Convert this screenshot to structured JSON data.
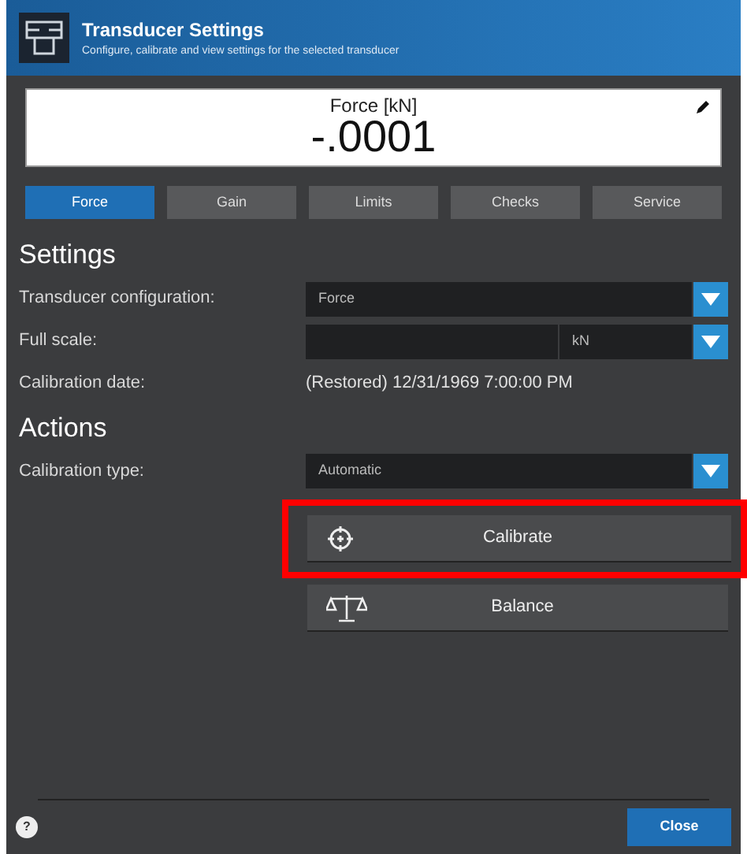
{
  "header": {
    "title": "Transducer Settings",
    "subtitle": "Configure, calibrate and view settings for the selected transducer"
  },
  "display": {
    "label": "Force [kN]",
    "value": "-.0001"
  },
  "tabs": [
    {
      "label": "Force",
      "selected": true
    },
    {
      "label": "Gain",
      "selected": false
    },
    {
      "label": "Limits",
      "selected": false
    },
    {
      "label": "Checks",
      "selected": false
    },
    {
      "label": "Service",
      "selected": false
    }
  ],
  "settings": {
    "heading": "Settings",
    "rows": [
      {
        "kind": "select",
        "label": "Transducer configuration:",
        "value": "Force"
      },
      {
        "kind": "scale",
        "label": "Full scale:",
        "unit": "kN"
      },
      {
        "kind": "text",
        "label": "Calibration date:",
        "value": "(Restored) 12/31/1969 7:00:00 PM"
      }
    ]
  },
  "actions": {
    "heading": "Actions",
    "rows": [
      {
        "kind": "select",
        "label": "Calibration type:",
        "value": "Automatic"
      }
    ],
    "buttons": [
      {
        "kind": "target",
        "label": "Calibrate",
        "highlighted": true
      },
      {
        "kind": "scale",
        "label": "Balance",
        "highlighted": false
      }
    ]
  },
  "footer": {
    "help": "?",
    "close": "Close"
  }
}
